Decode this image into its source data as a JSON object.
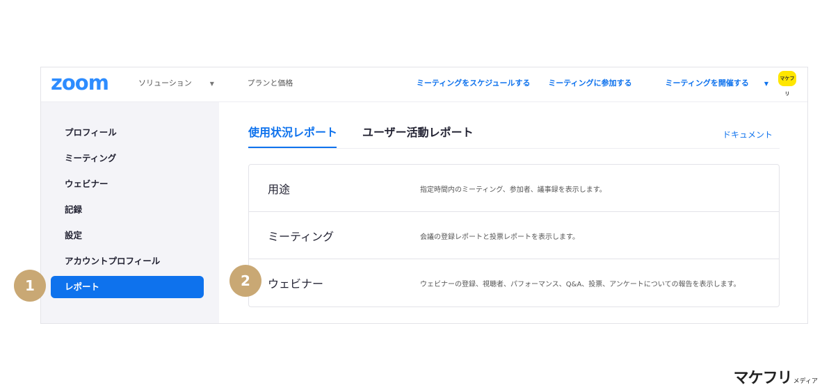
{
  "header": {
    "logo": "zoom",
    "nav_left": [
      {
        "label": "ソリューション",
        "has_caret": true
      },
      {
        "label": "プランと価格",
        "has_caret": false
      }
    ],
    "nav_right": [
      {
        "label": "ミーティングをスケジュールする"
      },
      {
        "label": "ミーティングに参加する"
      },
      {
        "label": "ミーティングを開催する",
        "has_caret": true
      }
    ],
    "avatar_text": "マケフリ"
  },
  "sidebar": {
    "items": [
      {
        "label": "プロフィール"
      },
      {
        "label": "ミーティング"
      },
      {
        "label": "ウェビナー"
      },
      {
        "label": "記録"
      },
      {
        "label": "設定"
      },
      {
        "label": "アカウントプロフィール"
      },
      {
        "label": "レポート",
        "active": true
      }
    ]
  },
  "main": {
    "tabs": [
      {
        "label": "使用状況レポート",
        "active": true
      },
      {
        "label": "ユーザー活動レポート",
        "active": false
      }
    ],
    "doc_link": "ドキュメント",
    "rows": [
      {
        "title": "用途",
        "desc": "指定時間内のミーティング、参加者、議事録を表示します。"
      },
      {
        "title": "ミーティング",
        "desc": "会議の登録レポートと投票レポートを表示します。"
      },
      {
        "title": "ウェビナー",
        "desc": "ウェビナーの登録、視聴者、パフォーマンス、Q&A、投票、アンケートについての報告を表示します。"
      }
    ]
  },
  "markers": [
    "1",
    "2"
  ],
  "brand": {
    "name": "マケフリ",
    "suffix": "メディア"
  },
  "colors": {
    "accent": "#0e72ed",
    "logo": "#2d8cff",
    "marker": "#c9a874",
    "avatar": "#ffe600"
  }
}
